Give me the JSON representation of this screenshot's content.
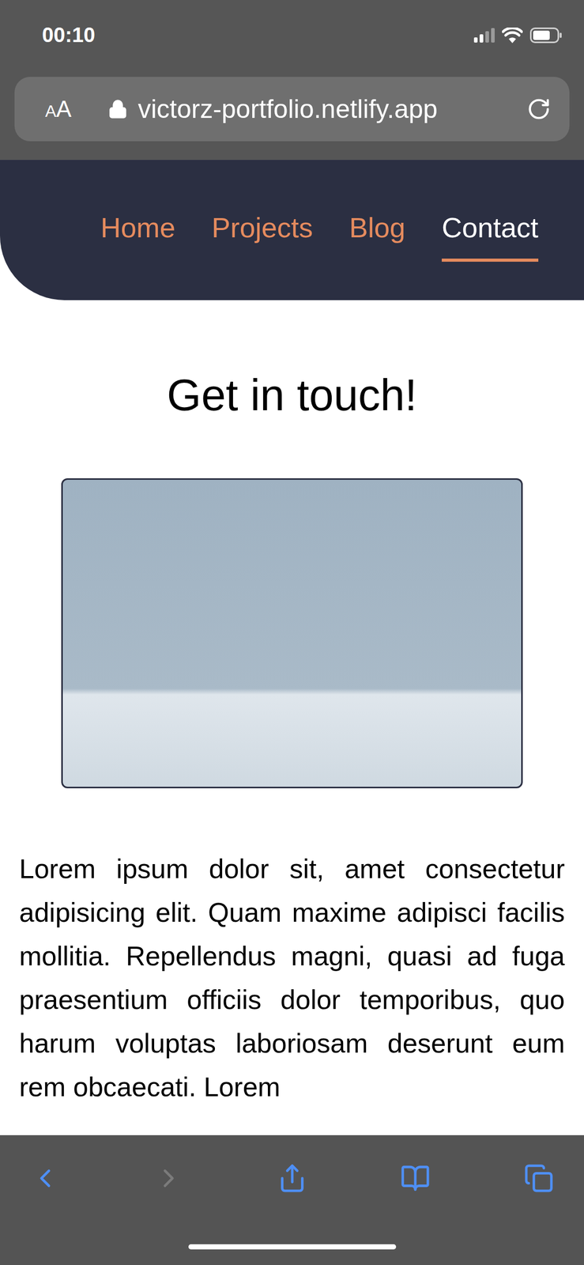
{
  "status_bar": {
    "time": "00:10"
  },
  "address_bar": {
    "text_size_button": "AA",
    "url": "victorz-portfolio.netlify.app"
  },
  "nav": {
    "items": [
      {
        "label": "Home",
        "selected": false
      },
      {
        "label": "Projects",
        "selected": false
      },
      {
        "label": "Blog",
        "selected": false
      },
      {
        "label": "Contact",
        "selected": true
      }
    ]
  },
  "heading": "Get in touch!",
  "paragraph": "Lorem ipsum dolor sit, amet consectetur adipisicing elit. Quam maxime adipisci facilis mollitia. Repellendus magni, quasi ad fuga praesentium officiis dolor temporibus, quo harum voluptas laboriosam deserunt eum rem obcaecati. Lorem",
  "toolbar": {
    "buttons": [
      {
        "kind": "back",
        "disabled": false
      },
      {
        "kind": "forward",
        "disabled": true
      },
      {
        "kind": "share",
        "disabled": false
      },
      {
        "kind": "bookmarks",
        "disabled": false
      },
      {
        "kind": "tabs",
        "disabled": false
      }
    ]
  }
}
